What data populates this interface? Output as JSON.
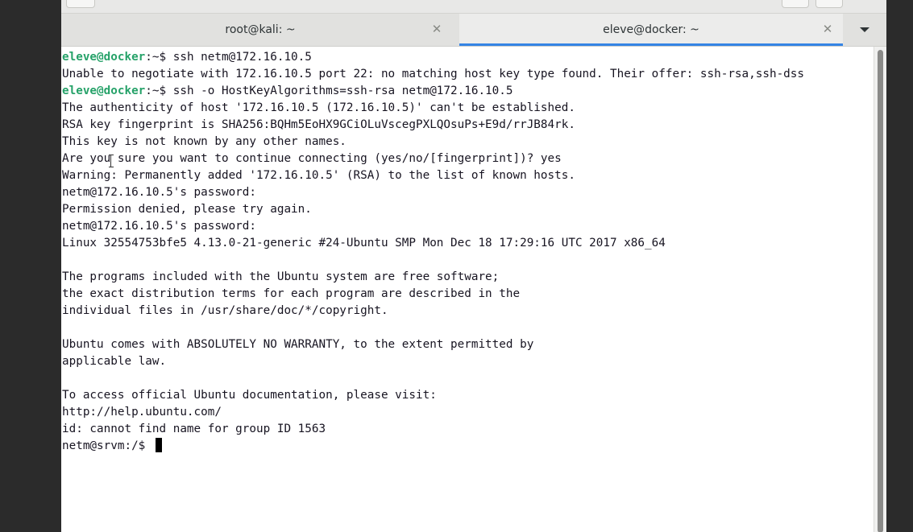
{
  "tabs": [
    {
      "label": "root@kali: ~",
      "active": false
    },
    {
      "label": "eleve@docker: ~",
      "active": true
    }
  ],
  "colors": {
    "accent": "#3584e4",
    "prompt": "#26a269"
  },
  "icons": {
    "close": "close-icon",
    "menu": "chevron-down-icon"
  },
  "terminal": {
    "lines": [
      {
        "user": "eleve@docker",
        "rest": ":~$ ssh netm@172.16.10.5"
      },
      {
        "text": "Unable to negotiate with 172.16.10.5 port 22: no matching host key type found. Their offer: ssh-rsa,ssh-dss"
      },
      {
        "user": "eleve@docker",
        "rest": ":~$ ssh -o HostKeyAlgorithms=ssh-rsa netm@172.16.10.5"
      },
      {
        "text": "The authenticity of host '172.16.10.5 (172.16.10.5)' can't be established."
      },
      {
        "text": "RSA key fingerprint is SHA256:BQHm5EoHX9GCiOLuVscegPXLQOsuPs+E9d/rrJB84rk."
      },
      {
        "text": "This key is not known by any other names."
      },
      {
        "text": "Are you sure you want to continue connecting (yes/no/[fingerprint])? yes"
      },
      {
        "text": "Warning: Permanently added '172.16.10.5' (RSA) to the list of known hosts."
      },
      {
        "text": "netm@172.16.10.5's password:"
      },
      {
        "text": "Permission denied, please try again."
      },
      {
        "text": "netm@172.16.10.5's password:"
      },
      {
        "text": "Linux 32554753bfe5 4.13.0-21-generic #24-Ubuntu SMP Mon Dec 18 17:29:16 UTC 2017 x86_64"
      },
      {
        "text": ""
      },
      {
        "text": "The programs included with the Ubuntu system are free software;"
      },
      {
        "text": "the exact distribution terms for each program are described in the"
      },
      {
        "text": "individual files in /usr/share/doc/*/copyright."
      },
      {
        "text": ""
      },
      {
        "text": "Ubuntu comes with ABSOLUTELY NO WARRANTY, to the extent permitted by"
      },
      {
        "text": "applicable law."
      },
      {
        "text": ""
      },
      {
        "text": "To access official Ubuntu documentation, please visit:"
      },
      {
        "text": "http://help.ubuntu.com/"
      },
      {
        "text": "id: cannot find name for group ID 1563"
      },
      {
        "text": "netm@srvm:/$ ",
        "cursor": true
      }
    ]
  }
}
